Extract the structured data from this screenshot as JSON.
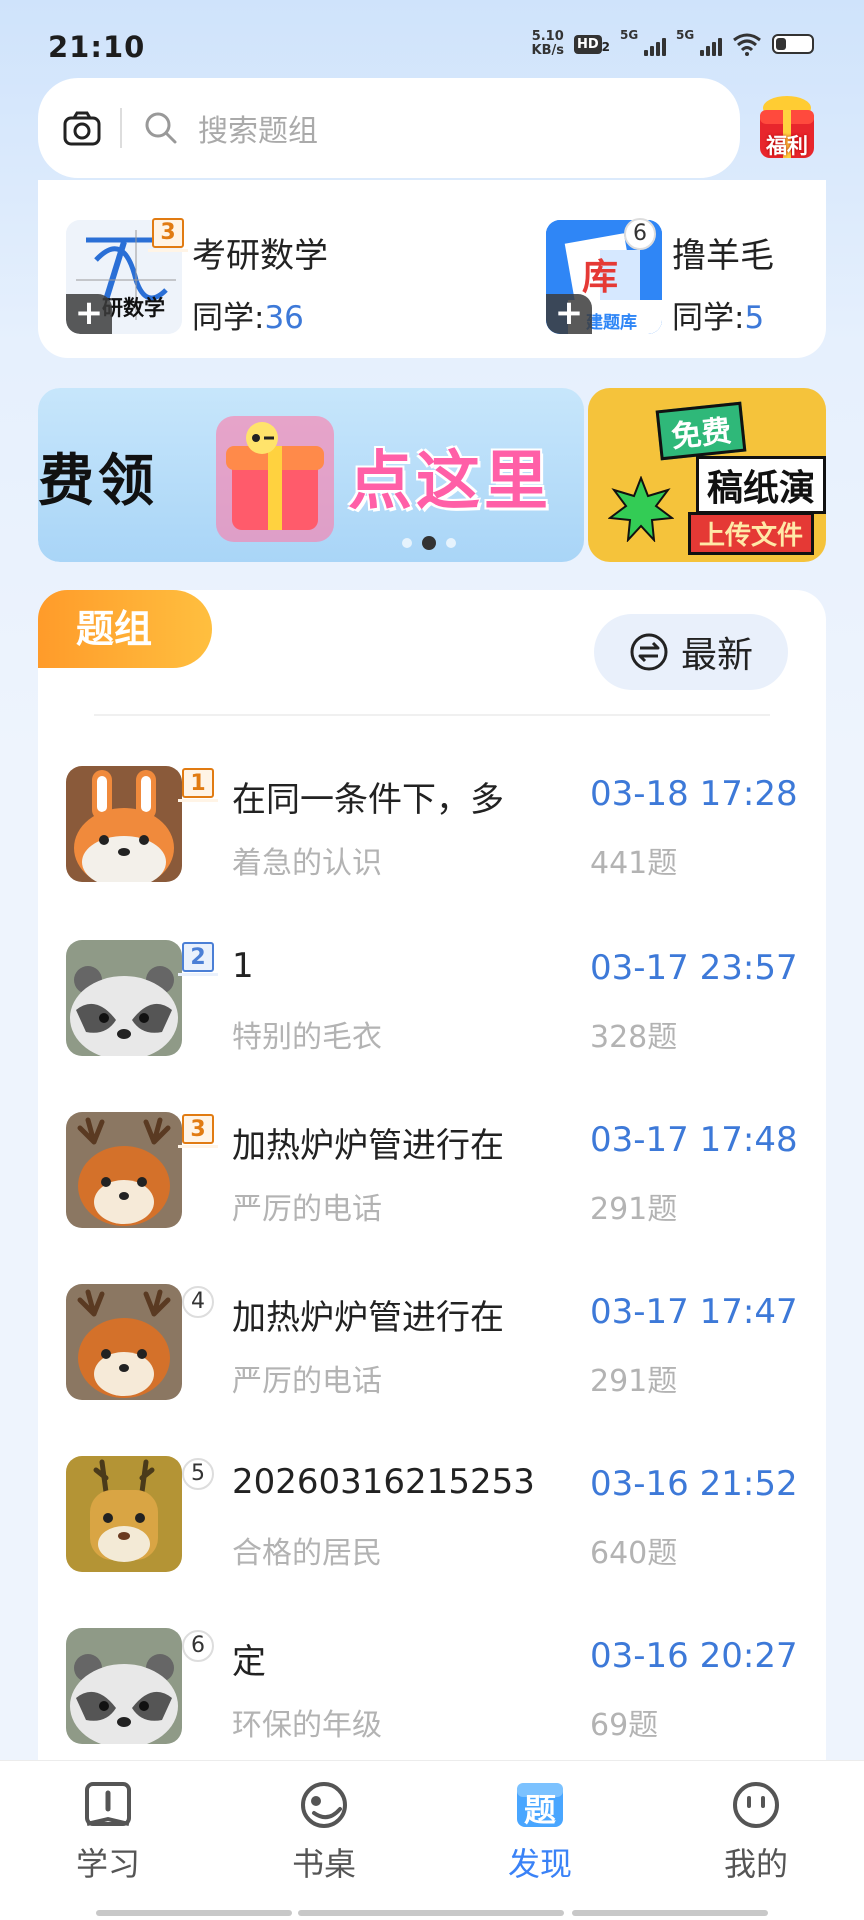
{
  "status_bar": {
    "time": "21:10",
    "net_speed_value": "5.10",
    "net_speed_unit": "KB/s",
    "hd_label": "HD",
    "hd_sub": "2",
    "sim1_tag": "5G",
    "sim1_sub": "1",
    "sim2_tag": "5G"
  },
  "search": {
    "placeholder": "搜索题组"
  },
  "welfare": {
    "label": "福利"
  },
  "featured_groups": [
    {
      "title": "考研数学",
      "stat_label": "同学:",
      "stat_value": "36",
      "rank": "3",
      "thumb_text": "研数学",
      "plus": "+"
    },
    {
      "title": "撸羊毛",
      "stat_label": "同学:",
      "stat_value": "5",
      "rank": "6",
      "thumb_text": "建题库",
      "thumb_char": "库",
      "plus": "+"
    }
  ],
  "banners": [
    {
      "left_text": "费领",
      "cta": "点这里"
    },
    {
      "free": "免费",
      "title": "稿纸演",
      "sub": "上传文件"
    }
  ],
  "list": {
    "tab_label": "题组",
    "sort_label": "最新",
    "rows": [
      {
        "rank": "1",
        "title": "在同一条件下，多",
        "author": "着急的认识",
        "time": "03-18 17:28",
        "count": "441题"
      },
      {
        "rank": "2",
        "title": "1",
        "author": "特别的毛衣",
        "time": "03-17 23:57",
        "count": "328题"
      },
      {
        "rank": "3",
        "title": "加热炉炉管进行在",
        "author": "严厉的电话",
        "time": "03-17 17:48",
        "count": "291题"
      },
      {
        "rank": "4",
        "title": "加热炉炉管进行在",
        "author": "严厉的电话",
        "time": "03-17 17:47",
        "count": "291题"
      },
      {
        "rank": "5",
        "title": "20260316215253",
        "author": "合格的居民",
        "time": "03-16 21:52",
        "count": "640题"
      },
      {
        "rank": "6",
        "title": "定",
        "author": "环保的年级",
        "time": "03-16 20:27",
        "count": "69题"
      }
    ]
  },
  "nav": {
    "items": [
      {
        "label": "学习",
        "icon": "book-icon"
      },
      {
        "label": "书桌",
        "icon": "desk-icon"
      },
      {
        "label": "发现",
        "icon": "discover-icon",
        "icon_text": "题"
      },
      {
        "label": "我的",
        "icon": "face-icon"
      }
    ],
    "active_index": 2
  },
  "colors": {
    "accent_blue": "#3d79d8",
    "tab_orange": "#ff9b2a",
    "nav_active": "#3a82f7"
  }
}
